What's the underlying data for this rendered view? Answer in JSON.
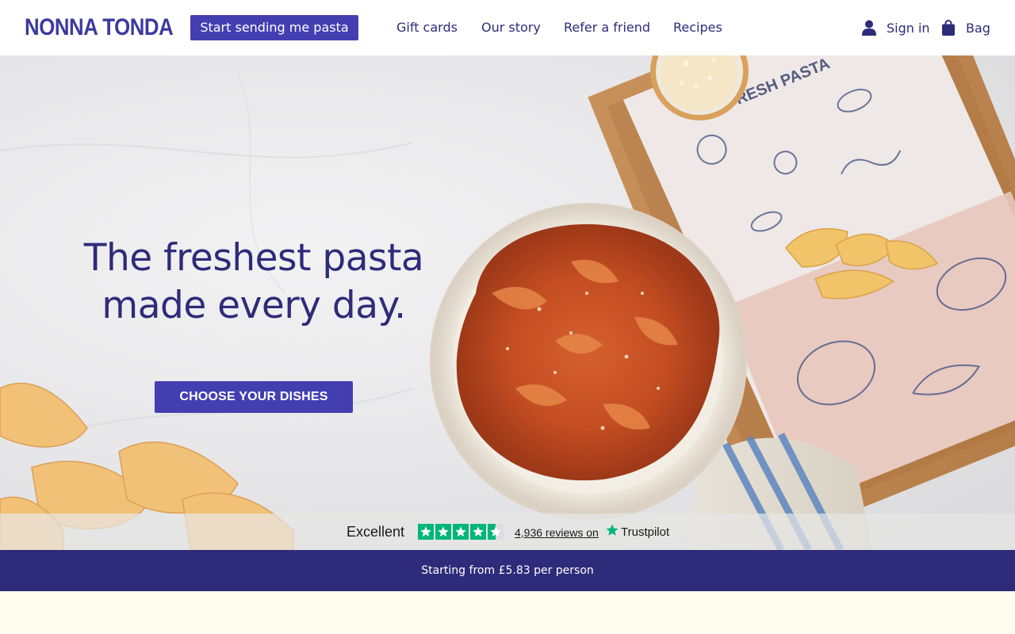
{
  "header": {
    "logo": "NONNA TONDA",
    "cta_label": "Start sending me pasta",
    "nav": [
      {
        "label": "Gift cards"
      },
      {
        "label": "Our story"
      },
      {
        "label": "Refer a friend"
      },
      {
        "label": "Recipes"
      }
    ],
    "sign_in": {
      "label": "Sign in",
      "icon": "user-icon"
    },
    "bag": {
      "label": "Bag",
      "icon": "shopping-bag-icon"
    }
  },
  "hero": {
    "headline_line1": "The freshest pasta",
    "headline_line2": "made every day.",
    "cta_label": "CHOOSE YOUR DISHES",
    "image_description_tokens": [
      "plate-of-pappardelle-ragu",
      "fresh-pasta-delivery-box",
      "parmesan-bowl",
      "striped-tea-towel"
    ]
  },
  "trustpilot": {
    "rating_word": "Excellent",
    "stars": 4.5,
    "reviews_text": "4,936 reviews on",
    "brand": "Trustpilot"
  },
  "price_bar": {
    "text": "Starting from £5.83 per person"
  },
  "colors": {
    "brand_primary": "#433fb0",
    "brand_dark": "#2e2b7a",
    "trustpilot_green": "#00b67a",
    "page_cream": "#fffcf0"
  }
}
